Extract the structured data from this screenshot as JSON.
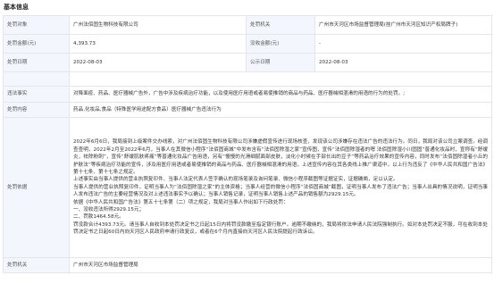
{
  "section_title": "基本信息",
  "rows": {
    "cancel_reason": {
      "label": "处罚对象"
    },
    "party": {
      "label": "违法行为类型",
      "value": "广州法佰固生物科技有限公司"
    },
    "decision_org": {
      "label": "处罚机关",
      "value": "广州市天河区市场监督管理局(挂广州市天河区知识产权局牌子)"
    },
    "amount": {
      "label": "处罚金额(元)",
      "value": "4,393.73",
      "label2": "没收金额(元)",
      "value2": "-"
    },
    "date": {
      "label": "处罚日期",
      "value": "2022-08-03",
      "label2": "公示日期",
      "value2": "2022-08-03"
    },
    "violation": {
      "label": "违法事实",
      "value": "对降面疫、药品、医疗器械广告外，广告中涉及疾病治疗功能，以及使用医疗用语或者易使推销的商品与药品、医疗器械相混淆的用语的行为的处罚。;"
    },
    "content": {
      "label": "处罚内容",
      "value": "药品,化妆品,食品（特殊医学用途配方食品）医疗器械广告违法行为"
    },
    "basis": {
      "label": "处罚依据",
      "paragraphs": [
        "2022年6月6日，我局接到上级案件交办线索，对广州法佰固生物科技有限公司涉嫌虚假宣传进行现场核查，发现该公司涉嫌存在违法广告的违法行为。同日，我局对该公司立案调查。经调查查明，2022年2月至2022年6月，当事人在其微信小程序“法佰固商城”中发布含有“法佰固除湿之家”宣传图，宣传“法佰固除湿者的嗯 法佰固除湿小川固固”普通化妆品时，宣称有“舒缓炎，祛除粉刺”，宣传“舒缓肌肤疼痛”等普通化妆品广告用语，另有“慢慢的光滑细腻面部皮肤，淡化小时候在手部长出的豆子”等药品治疗效果的宣传内容，同时发布“法佰固除湿者小丘的护肤法”等疾病治疗功能的宣传，涉及用医疗用语或者易使推销的商品与药品、医疗器械相混淆的用语，上述宣传内容在其各类线上推广渠道中，以上行为违反了《中华人民共和国广告法》第十七条、第十七条之规定。",
        "上述事实由当事人提供的营业执照复印件、当事人法定代表人签字确认的现场笔录及询问笔录、微信小程序截图等证据证实，证据确凿，足以认定。",
        "当事人提供的营业执照复印件，证明当事人为“法佰固除湿之家”的主体资格；当事人经营的微信小程序“法佰固商城”截图，证明当事人发布了违法广告；当事人出具的情况说明，证明当事人发布违法广告的主要经营情况及对上述违法事实予以确认；当事人销售记录，证明当事人销售上述产品的销售额为2929.15元。",
        "依据《中华人民共和国广告法》第五十七条第（二）项之规定，我局对当事人作出如下行政处罚：",
        "一、没收违法所得2929.15元；",
        "二、罚款1464.58元。",
        "罚没款合计4393.73元。请当事人自收到本处罚决定书之日起15日内将罚没款缴至指定银行账户。逾期不缴纳的，我局将依法申请人民法院强制执行。如对本处罚决定不服，可在收到本处罚决定书之日起60日内向天河区人民政府申请行政复议，或者在6个月内直接向天河区人民法院提起行政诉讼。"
      ]
    },
    "org2": {
      "label": "处罚机关",
      "value": "广州市天河区市场监督管理局"
    }
  }
}
